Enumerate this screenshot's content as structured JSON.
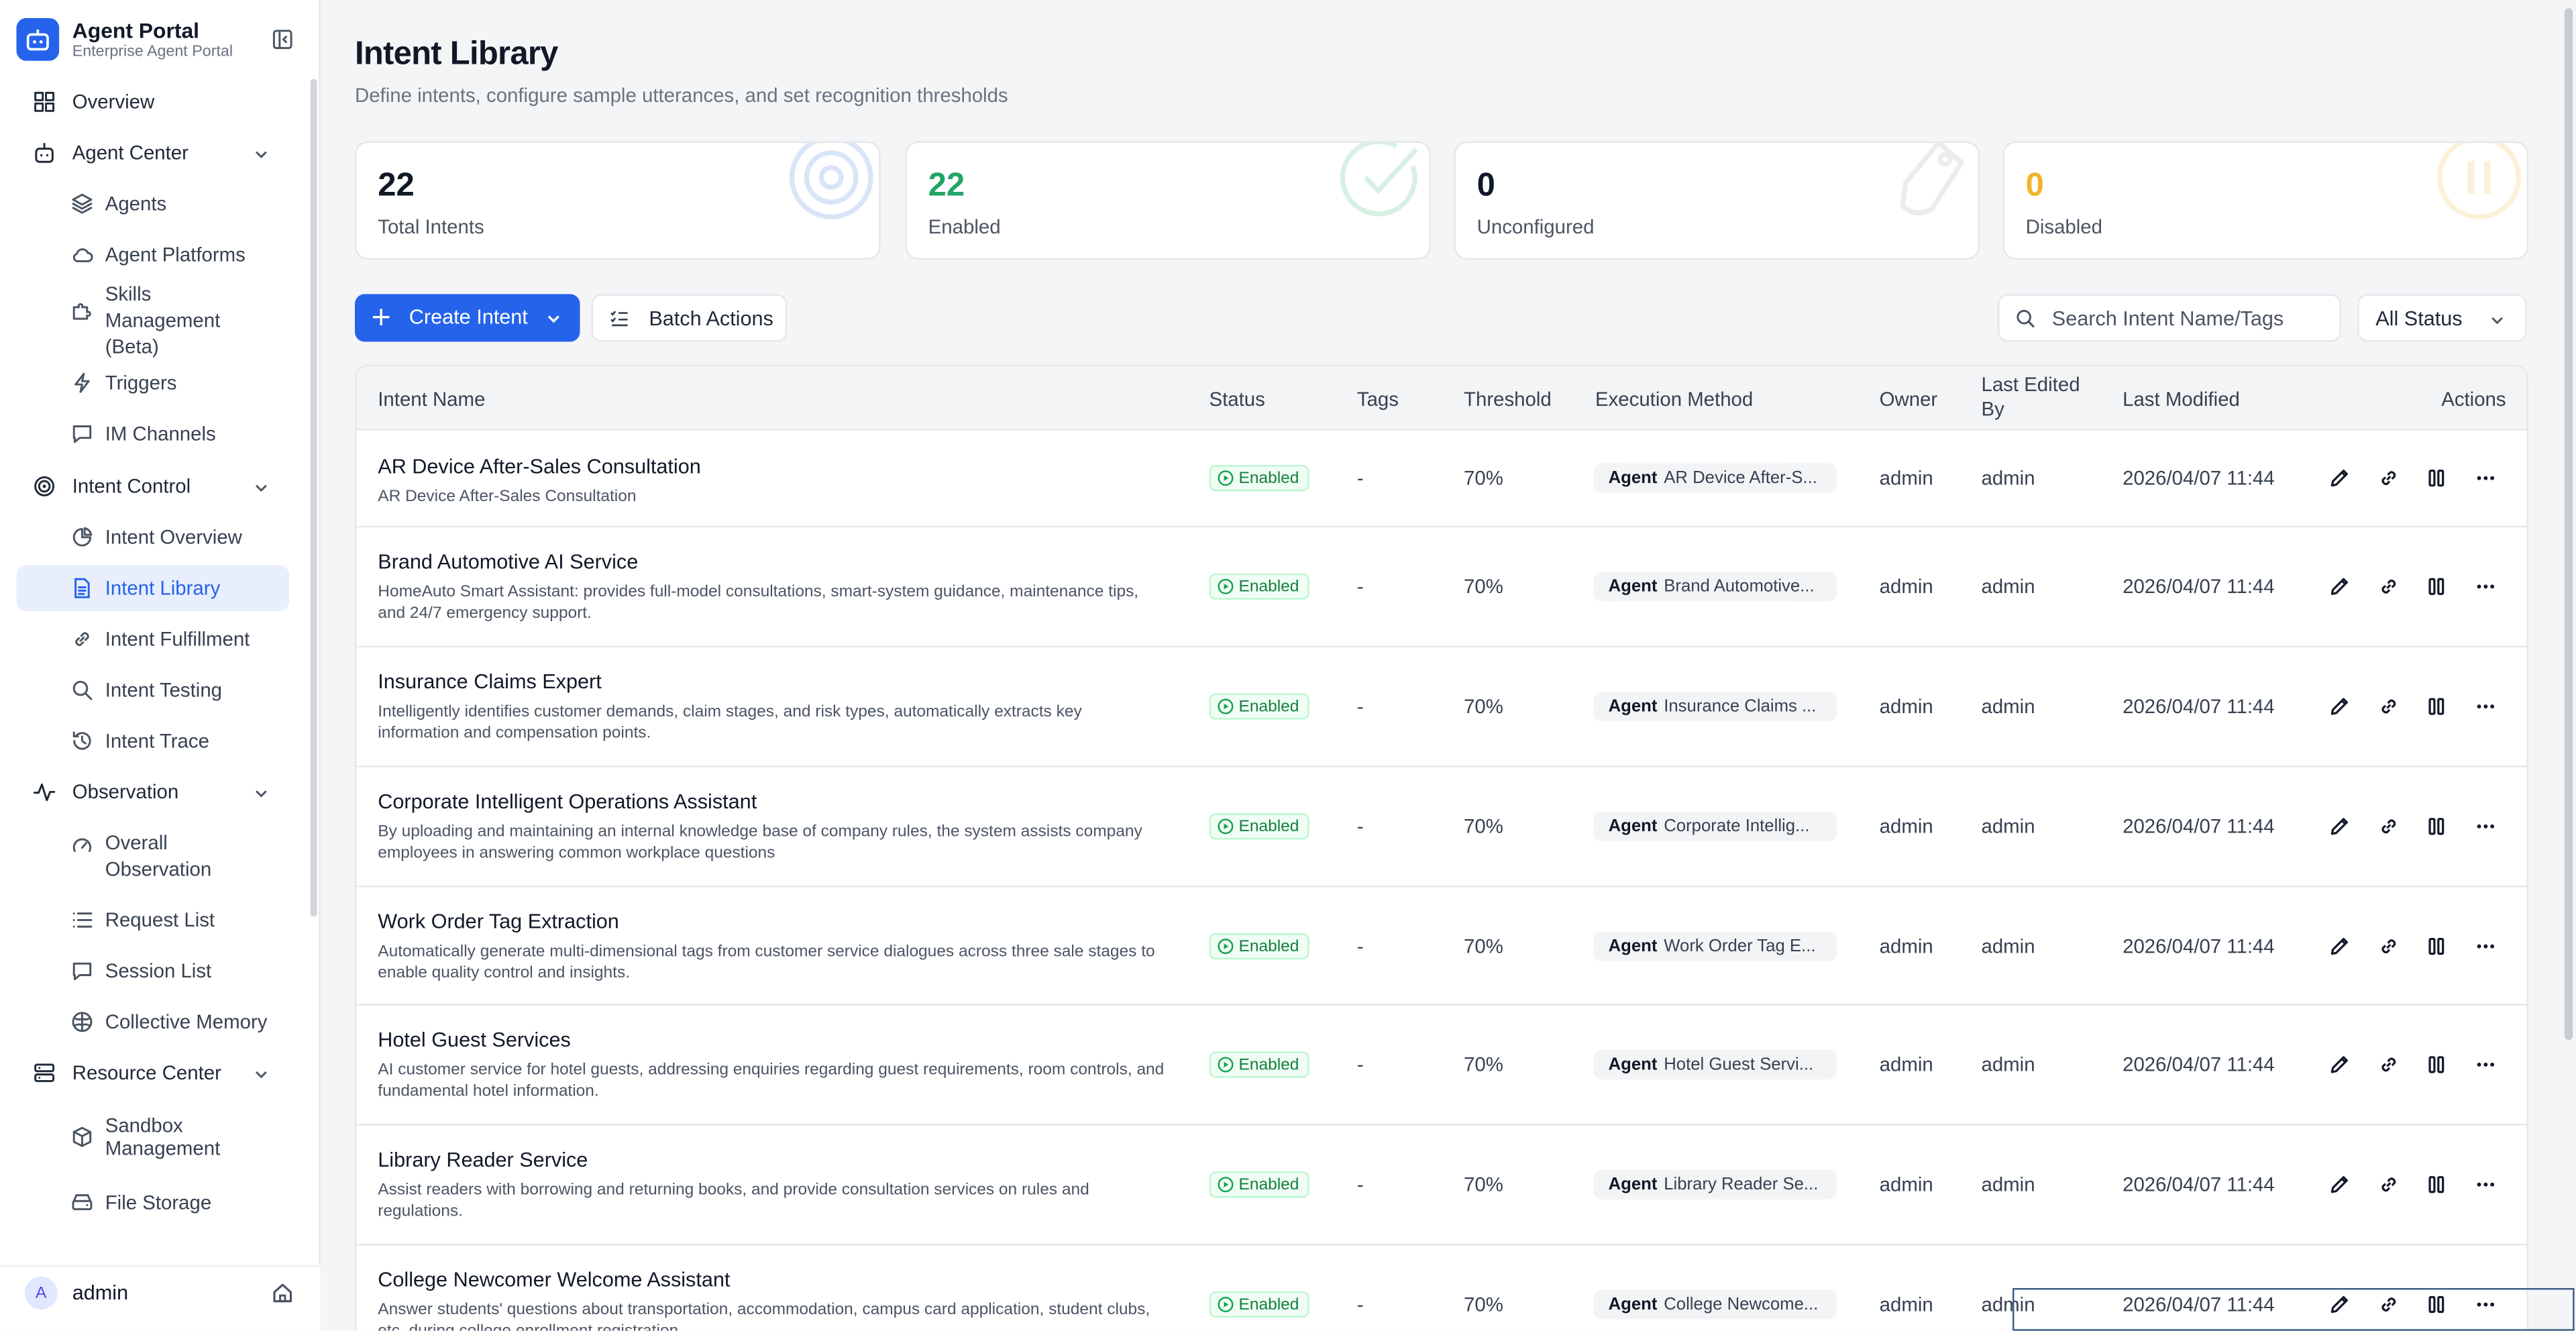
{
  "app": {
    "title": "Agent Portal",
    "subtitle": "Enterprise Agent Portal"
  },
  "sidebar": {
    "items": [
      {
        "label": "Overview",
        "icon": "grid-icon",
        "level": "top"
      },
      {
        "label": "Agent Center",
        "icon": "bot-icon",
        "level": "top",
        "expanded": true
      },
      {
        "label": "Agents",
        "icon": "layers-icon",
        "level": "child"
      },
      {
        "label": "Agent Platforms",
        "icon": "cloud-icon",
        "level": "child"
      },
      {
        "label": "Skills Management (Beta)",
        "icon": "puzzle-icon",
        "level": "child"
      },
      {
        "label": "Triggers",
        "icon": "bolt-icon",
        "level": "child"
      },
      {
        "label": "IM Channels",
        "icon": "chat-icon",
        "level": "child"
      },
      {
        "label": "Intent Control",
        "icon": "target-icon",
        "level": "top",
        "expanded": true
      },
      {
        "label": "Intent Overview",
        "icon": "pie-icon",
        "level": "child"
      },
      {
        "label": "Intent Library",
        "icon": "document-icon",
        "level": "child",
        "active": true
      },
      {
        "label": "Intent Fulfillment",
        "icon": "link-icon",
        "level": "child"
      },
      {
        "label": "Intent Testing",
        "icon": "search-icon",
        "level": "child"
      },
      {
        "label": "Intent Trace",
        "icon": "history-icon",
        "level": "child"
      },
      {
        "label": "Observation",
        "icon": "pulse-icon",
        "level": "top",
        "expanded": true
      },
      {
        "label": "Overall Observation",
        "icon": "gauge-icon",
        "level": "child"
      },
      {
        "label": "Request List",
        "icon": "list-icon",
        "level": "child"
      },
      {
        "label": "Session List",
        "icon": "chat-icon",
        "level": "child"
      },
      {
        "label": "Collective Memory",
        "icon": "brain-icon",
        "level": "child"
      },
      {
        "label": "Resource Center",
        "icon": "server-icon",
        "level": "top",
        "expanded": true
      },
      {
        "label": "Sandbox Management",
        "icon": "box-icon",
        "level": "child"
      },
      {
        "label": "File Storage",
        "icon": "drive-icon",
        "level": "child"
      }
    ],
    "user": {
      "initial": "A",
      "name": "admin"
    }
  },
  "page": {
    "title": "Intent Library",
    "subtitle": "Define intents, configure sample utterances, and set recognition thresholds"
  },
  "stats": [
    {
      "value": "22",
      "label": "Total Intents",
      "color": "#111827",
      "icon": "target-icon"
    },
    {
      "value": "22",
      "label": "Enabled",
      "color": "#22a565",
      "icon": "check-circle-icon"
    },
    {
      "value": "0",
      "label": "Unconfigured",
      "color": "#111827",
      "icon": "tag-icon"
    },
    {
      "value": "0",
      "label": "Disabled",
      "color": "#f0b429",
      "icon": "pause-circle-icon"
    }
  ],
  "toolbar": {
    "create_label": "Create Intent",
    "batch_label": "Batch Actions",
    "search_placeholder": "Search Intent Name/Tags",
    "status_filter": "All Status"
  },
  "table": {
    "headers": {
      "name": "Intent Name",
      "status": "Status",
      "tags": "Tags",
      "threshold": "Threshold",
      "exec": "Execution Method",
      "owner": "Owner",
      "last_edited_by": "Last Edited By",
      "last_modified": "Last Modified",
      "actions": "Actions"
    },
    "rows": [
      {
        "name": "AR Device After-Sales Consultation",
        "desc": "AR Device After-Sales Consultation",
        "status": "Enabled",
        "tags": "-",
        "threshold": "70%",
        "exec_type": "Agent",
        "exec_name": "AR Device After-S...",
        "owner": "admin",
        "editor": "admin",
        "modified": "2026/04/07 11:44"
      },
      {
        "name": "Brand Automotive AI Service",
        "desc": "HomeAuto Smart Assistant: provides full-model consultations, smart-system guidance, maintenance tips, and 24/7 emergency support.",
        "status": "Enabled",
        "tags": "-",
        "threshold": "70%",
        "exec_type": "Agent",
        "exec_name": "Brand Automotive...",
        "owner": "admin",
        "editor": "admin",
        "modified": "2026/04/07 11:44"
      },
      {
        "name": "Insurance Claims Expert",
        "desc": "Intelligently identifies customer demands, claim stages, and risk types, automatically extracts key information and compensation points.",
        "status": "Enabled",
        "tags": "-",
        "threshold": "70%",
        "exec_type": "Agent",
        "exec_name": "Insurance Claims ...",
        "owner": "admin",
        "editor": "admin",
        "modified": "2026/04/07 11:44"
      },
      {
        "name": "Corporate Intelligent Operations Assistant",
        "desc": "By uploading and maintaining an internal knowledge base of company rules, the system assists company employees in answering common workplace questions",
        "status": "Enabled",
        "tags": "-",
        "threshold": "70%",
        "exec_type": "Agent",
        "exec_name": "Corporate Intellig...",
        "owner": "admin",
        "editor": "admin",
        "modified": "2026/04/07 11:44"
      },
      {
        "name": "Work Order Tag Extraction",
        "desc": "Automatically generate multi-dimensional tags from customer service dialogues across three sale stages to enable quality control and insights.",
        "status": "Enabled",
        "tags": "-",
        "threshold": "70%",
        "exec_type": "Agent",
        "exec_name": "Work Order Tag E...",
        "owner": "admin",
        "editor": "admin",
        "modified": "2026/04/07 11:44"
      },
      {
        "name": "Hotel Guest Services",
        "desc": "AI customer service for hotel guests, addressing enquiries regarding guest requirements, room controls, and fundamental hotel information.",
        "status": "Enabled",
        "tags": "-",
        "threshold": "70%",
        "exec_type": "Agent",
        "exec_name": "Hotel Guest Servi...",
        "owner": "admin",
        "editor": "admin",
        "modified": "2026/04/07 11:44"
      },
      {
        "name": "Library Reader Service",
        "desc": "Assist readers with borrowing and returning books, and provide consultation services on rules and regulations.",
        "status": "Enabled",
        "tags": "-",
        "threshold": "70%",
        "exec_type": "Agent",
        "exec_name": "Library Reader Se...",
        "owner": "admin",
        "editor": "admin",
        "modified": "2026/04/07 11:44"
      },
      {
        "name": "College Newcomer Welcome Assistant",
        "desc": "Answer students' questions about transportation, accommodation, campus card application, student clubs, etc. during college enrollment registration",
        "status": "Enabled",
        "tags": "-",
        "threshold": "70%",
        "exec_type": "Agent",
        "exec_name": "College Newcome...",
        "owner": "admin",
        "editor": "admin",
        "modified": "2026/04/07 11:44"
      }
    ]
  }
}
